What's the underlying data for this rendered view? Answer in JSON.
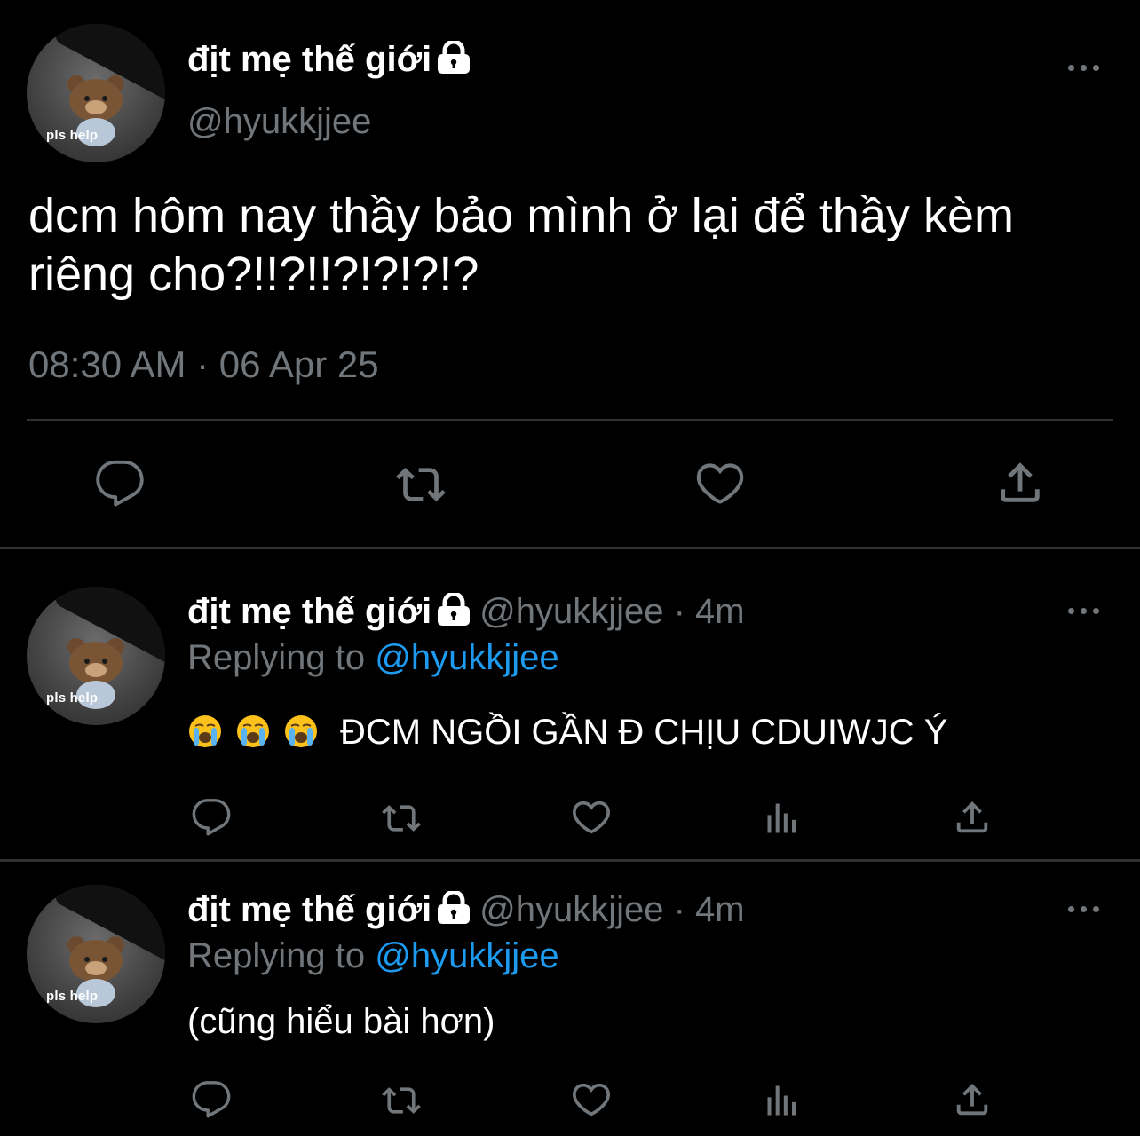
{
  "main_tweet": {
    "avatar_caption": "pls help",
    "display_name": "địt mẹ thế giới",
    "handle": "@hyukkjjee",
    "text": "dcm hôm nay thầy bảo mình ở lại để thầy kèm riêng cho?!!?!!?!?!?!?",
    "time": "08:30 AM",
    "separator": " · ",
    "date": "06 Apr 25",
    "actions": [
      "reply-icon",
      "retweet-icon",
      "like-icon",
      "share-icon"
    ]
  },
  "replies": [
    {
      "avatar_caption": "pls help",
      "display_name": "địt mẹ thế giới",
      "handle": "@hyukkjjee",
      "dot": " · ",
      "time": "4m",
      "replying_prefix": "Replying to ",
      "replying_to": "@hyukkjjee",
      "emojis": [
        "loudly-crying-face",
        "loudly-crying-face",
        "loudly-crying-face"
      ],
      "text": "ĐCM NGỒI GẦN Đ CHỊU CDUIWJC Ý",
      "actions": [
        "reply-icon",
        "retweet-icon",
        "like-icon",
        "analytics-icon",
        "share-icon"
      ]
    },
    {
      "avatar_caption": "pls help",
      "display_name": "địt mẹ thế giới",
      "handle": "@hyukkjjee",
      "dot": " · ",
      "time": "4m",
      "replying_prefix": "Replying to ",
      "replying_to": "@hyukkjjee",
      "text": "(cũng hiểu bài hơn)",
      "actions": [
        "reply-icon",
        "retweet-icon",
        "like-icon",
        "analytics-icon",
        "share-icon"
      ]
    }
  ],
  "colors": {
    "background": "#000000",
    "primary_text": "#ffffff",
    "secondary_text": "#71767b",
    "link": "#1d9bf0",
    "divider": "#2f3336"
  }
}
